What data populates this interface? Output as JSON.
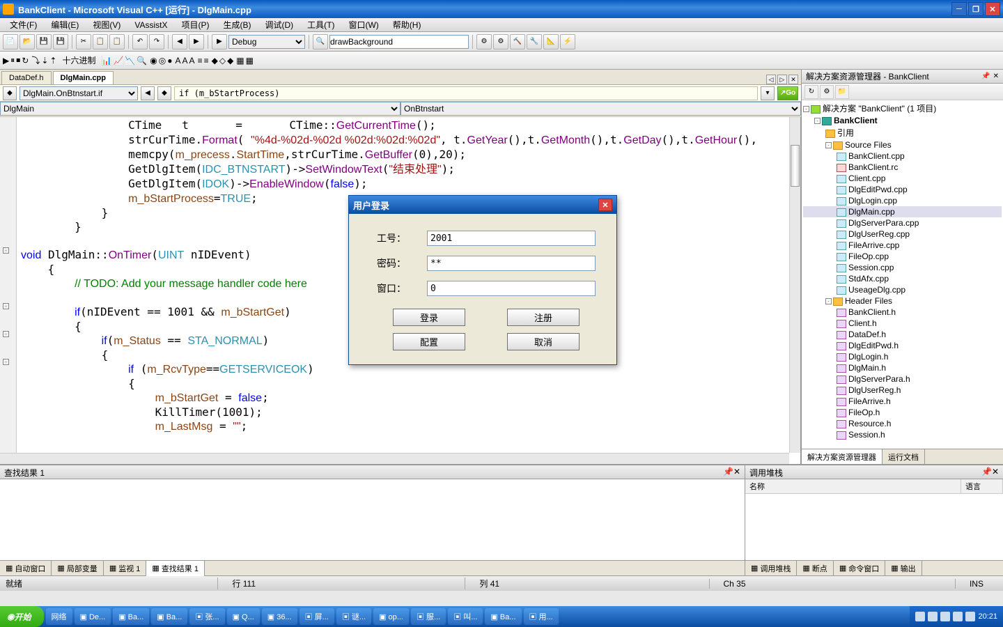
{
  "window": {
    "title": "BankClient - Microsoft Visual C++ [运行] - DlgMain.cpp"
  },
  "menus": [
    "文件(F)",
    "编辑(E)",
    "视图(V)",
    "VAssistX",
    "项目(P)",
    "生成(B)",
    "调试(D)",
    "工具(T)",
    "窗口(W)",
    "帮助(H)"
  ],
  "toolbar1": {
    "config": "Debug",
    "find": "drawBackground",
    "hexlabel": "十六进制"
  },
  "file_tabs": {
    "t1": "DataDef.h",
    "t2": "DlgMain.cpp"
  },
  "navbar": {
    "scope": "DlgMain.OnBtnstart.if",
    "loc": "if (m_bStartProcess)",
    "go": "Go"
  },
  "classbar": {
    "left": "DlgMain",
    "right": "OnBtnstart"
  },
  "code_lines": [
    {
      "ind": 4,
      "tokens": [
        {
          "t": "CTime\tt\t= \tCTime",
          "c": ""
        },
        {
          "t": "::",
          "c": ""
        },
        {
          "t": "GetCurrentTime",
          "c": "kw-purple"
        },
        {
          "t": "();",
          "c": ""
        }
      ]
    },
    {
      "ind": 4,
      "tokens": [
        {
          "t": "strCurTime.",
          "c": ""
        },
        {
          "t": "Format",
          "c": "kw-purple"
        },
        {
          "t": "( ",
          "c": ""
        },
        {
          "t": "\"%4d-%02d-%02d %02d:%02d:%02d\"",
          "c": "kw-red"
        },
        {
          "t": ", t.",
          "c": ""
        },
        {
          "t": "GetYear",
          "c": "kw-purple"
        },
        {
          "t": "(),t.",
          "c": ""
        },
        {
          "t": "GetMonth",
          "c": "kw-purple"
        },
        {
          "t": "(),t.",
          "c": ""
        },
        {
          "t": "GetDay",
          "c": "kw-purple"
        },
        {
          "t": "(),t.",
          "c": ""
        },
        {
          "t": "GetHour",
          "c": "kw-purple"
        },
        {
          "t": "(),",
          "c": ""
        }
      ]
    },
    {
      "ind": 4,
      "tokens": [
        {
          "t": "memcpy(",
          "c": ""
        },
        {
          "t": "m_precess",
          "c": "kw-brown"
        },
        {
          "t": ".",
          "c": ""
        },
        {
          "t": "StartTime",
          "c": "kw-brown"
        },
        {
          "t": ",strCurTime.",
          "c": ""
        },
        {
          "t": "GetBuffer",
          "c": "kw-purple"
        },
        {
          "t": "(0),20);",
          "c": ""
        }
      ]
    },
    {
      "ind": 4,
      "tokens": [
        {
          "t": "GetDlgItem(",
          "c": ""
        },
        {
          "t": "IDC_BTNSTART",
          "c": "kw-teal"
        },
        {
          "t": ")->",
          "c": ""
        },
        {
          "t": "SetWindowText",
          "c": "kw-purple"
        },
        {
          "t": "(",
          "c": ""
        },
        {
          "t": "\"结束处理\"",
          "c": "kw-red"
        },
        {
          "t": ");",
          "c": ""
        }
      ]
    },
    {
      "ind": 4,
      "tokens": [
        {
          "t": "GetDlgItem(",
          "c": ""
        },
        {
          "t": "IDOK",
          "c": "kw-teal"
        },
        {
          "t": ")->",
          "c": ""
        },
        {
          "t": "EnableWindow",
          "c": "kw-purple"
        },
        {
          "t": "(",
          "c": ""
        },
        {
          "t": "false",
          "c": "kw-blue"
        },
        {
          "t": ");",
          "c": ""
        }
      ]
    },
    {
      "ind": 4,
      "tokens": [
        {
          "t": "m_bStartProcess",
          "c": "kw-brown"
        },
        {
          "t": "=",
          "c": ""
        },
        {
          "t": "TRUE",
          "c": "kw-teal"
        },
        {
          "t": ";",
          "c": ""
        }
      ]
    },
    {
      "ind": 3,
      "tokens": [
        {
          "t": "}",
          "c": ""
        }
      ]
    },
    {
      "ind": 2,
      "tokens": [
        {
          "t": "}",
          "c": ""
        }
      ]
    },
    {
      "ind": 0,
      "tokens": [
        {
          "t": "",
          "c": ""
        }
      ]
    },
    {
      "ind": 0,
      "fold": "⊟",
      "tokens": [
        {
          "t": "void",
          "c": "kw-blue"
        },
        {
          "t": " DlgMain::",
          "c": ""
        },
        {
          "t": "OnTimer",
          "c": "kw-purple"
        },
        {
          "t": "(",
          "c": ""
        },
        {
          "t": "UINT",
          "c": "kw-teal"
        },
        {
          "t": " nIDEvent)",
          "c": ""
        }
      ]
    },
    {
      "ind": 1,
      "tokens": [
        {
          "t": "{",
          "c": ""
        }
      ]
    },
    {
      "ind": 2,
      "tokens": [
        {
          "t": "// TODO: Add your message handler code here",
          "c": "kw-green"
        }
      ]
    },
    {
      "ind": 0,
      "tokens": [
        {
          "t": "",
          "c": ""
        }
      ]
    },
    {
      "ind": 2,
      "fold": "⊟",
      "tokens": [
        {
          "t": "if",
          "c": "kw-blue"
        },
        {
          "t": "(nIDEvent == 1001 && ",
          "c": ""
        },
        {
          "t": "m_bStartGet",
          "c": "kw-brown"
        },
        {
          "t": ")",
          "c": ""
        }
      ]
    },
    {
      "ind": 2,
      "tokens": [
        {
          "t": "{",
          "c": ""
        }
      ]
    },
    {
      "ind": 3,
      "fold": "⊟",
      "tokens": [
        {
          "t": "if",
          "c": "kw-blue"
        },
        {
          "t": "(",
          "c": ""
        },
        {
          "t": "m_Status",
          "c": "kw-brown"
        },
        {
          "t": " == ",
          "c": ""
        },
        {
          "t": "STA_NORMAL",
          "c": "kw-teal"
        },
        {
          "t": ")",
          "c": ""
        }
      ]
    },
    {
      "ind": 3,
      "tokens": [
        {
          "t": "{",
          "c": ""
        }
      ]
    },
    {
      "ind": 4,
      "fold": "⊟",
      "tokens": [
        {
          "t": "if",
          "c": "kw-blue"
        },
        {
          "t": " (",
          "c": ""
        },
        {
          "t": "m_RcvType",
          "c": "kw-brown"
        },
        {
          "t": "==",
          "c": ""
        },
        {
          "t": "GETSERVICEOK",
          "c": "kw-teal"
        },
        {
          "t": ")",
          "c": ""
        }
      ]
    },
    {
      "ind": 4,
      "tokens": [
        {
          "t": "{",
          "c": ""
        }
      ]
    },
    {
      "ind": 5,
      "tokens": [
        {
          "t": "m_bStartGet",
          "c": "kw-brown"
        },
        {
          "t": " = ",
          "c": ""
        },
        {
          "t": "false",
          "c": "kw-blue"
        },
        {
          "t": ";",
          "c": ""
        }
      ]
    },
    {
      "ind": 5,
      "tokens": [
        {
          "t": "KillTimer(1001);",
          "c": ""
        }
      ]
    },
    {
      "ind": 5,
      "tokens": [
        {
          "t": "m_LastMsg",
          "c": "kw-brown"
        },
        {
          "t": " = ",
          "c": ""
        },
        {
          "t": "\"\"",
          "c": "kw-red"
        },
        {
          "t": ";",
          "c": ""
        }
      ]
    }
  ],
  "solution": {
    "title": "解决方案资源管理器 - BankClient",
    "root": "解决方案 \"BankClient\" (1 项目)",
    "proj": "BankClient",
    "ref": "引用",
    "src": "Source Files",
    "hdr": "Header Files",
    "src_files": [
      "BankClient.cpp",
      "BankClient.rc",
      "Client.cpp",
      "DlgEditPwd.cpp",
      "DlgLogin.cpp",
      "DlgMain.cpp",
      "DlgServerPara.cpp",
      "DlgUserReg.cpp",
      "FileArrive.cpp",
      "FileOp.cpp",
      "Session.cpp",
      "StdAfx.cpp",
      "UseageDlg.cpp"
    ],
    "hdr_files": [
      "BankClient.h",
      "Client.h",
      "DataDef.h",
      "DlgEditPwd.h",
      "DlgLogin.h",
      "DlgMain.h",
      "DlgServerPara.h",
      "DlgUserReg.h",
      "FileArrive.h",
      "FileOp.h",
      "Resource.h",
      "Session.h"
    ],
    "tabs": {
      "a": "解决方案资源管理器",
      "b": "运行文档"
    }
  },
  "findpanel": {
    "title": "查找结果 1",
    "tabs": [
      "自动窗口",
      "局部变量",
      "监视 1",
      "查找结果 1"
    ]
  },
  "callpanel": {
    "title": "调用堆栈",
    "col1": "名称",
    "col2": "语言",
    "tabs": [
      "调用堆栈",
      "断点",
      "命令窗口",
      "输出"
    ]
  },
  "status": {
    "ready": "就绪",
    "line": "行 111",
    "col": "列 41",
    "ch": "Ch 35",
    "ins": "INS"
  },
  "modal": {
    "title": "用户登录",
    "l_id": "工号：",
    "l_pw": "密码：",
    "l_win": "窗口：",
    "v_id": "2001",
    "v_pw": "**",
    "v_win": "0",
    "b_login": "登录",
    "b_reg": "注册",
    "b_cfg": "配置",
    "b_cancel": "取消"
  },
  "taskbar": {
    "start": "开始",
    "net": "网络",
    "items": [
      "De...",
      "Ba...",
      "Ba...",
      "张...",
      "Q...",
      "36...",
      "屏...",
      "谜...",
      "op...",
      "服...",
      "叫...",
      "Ba...",
      "用..."
    ],
    "clock": "20:21"
  }
}
